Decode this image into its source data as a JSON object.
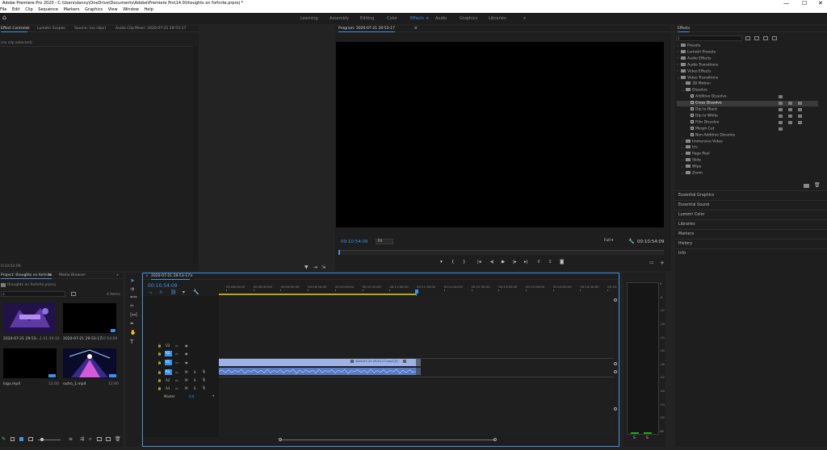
{
  "titlebar": {
    "title": "Adobe Premiere Pro 2020 - C:\\Users\\danny\\OneDrive\\Documents\\Adobe\\Premiere Pro\\14.0\\thoughts on fortnite.prproj *",
    "minimize": "—",
    "maximize": "☐"
  },
  "menu": [
    "File",
    "Edit",
    "Clip",
    "Sequence",
    "Markers",
    "Graphics",
    "View",
    "Window",
    "Help"
  ],
  "workspaces": {
    "items": [
      "Learning",
      "Assembly",
      "Editing",
      "Color",
      "Effects",
      "Audio",
      "Graphics",
      "Libraries"
    ],
    "active": "Effects",
    "more": "»",
    "menu_icon": "≡"
  },
  "source_panel": {
    "tabs": [
      "Effect Controls",
      "Lumetri Scopes",
      "Source: (no clips)",
      "Audio Clip Mixer: 2020-07-21 29-53-17"
    ],
    "tab_menu": "≡",
    "no_clip": "(no clip selected)",
    "timecode": "0:10:54:09"
  },
  "program": {
    "title": "Program: 2020-07-21 29-53-17",
    "timecode": "00:10:54:09",
    "fit": "Fit",
    "quality": "Full",
    "duration": "00:10:54:09"
  },
  "effects_panel": {
    "title": "Effects",
    "search_placeholder": "",
    "tree": [
      {
        "label": "Presets",
        "level": 0,
        "kind": "folder"
      },
      {
        "label": "Lumetri Presets",
        "level": 0,
        "kind": "folder"
      },
      {
        "label": "Audio Effects",
        "level": 0,
        "kind": "folder"
      },
      {
        "label": "Audio Transitions",
        "level": 0,
        "kind": "folder"
      },
      {
        "label": "Video Effects",
        "level": 0,
        "kind": "folder"
      },
      {
        "label": "Video Transitions",
        "level": 0,
        "kind": "folder",
        "open": true
      },
      {
        "label": "3D Motion",
        "level": 1,
        "kind": "folder"
      },
      {
        "label": "Dissolve",
        "level": 1,
        "kind": "folder",
        "open": true
      },
      {
        "label": "Additive Dissolve",
        "level": 2,
        "kind": "fx"
      },
      {
        "label": "Cross Dissolve",
        "level": 2,
        "kind": "fx",
        "selected": true
      },
      {
        "label": "Dip to Black",
        "level": 2,
        "kind": "fx"
      },
      {
        "label": "Dip to White",
        "level": 2,
        "kind": "fx"
      },
      {
        "label": "Film Dissolve",
        "level": 2,
        "kind": "fx"
      },
      {
        "label": "Morph Cut",
        "level": 2,
        "kind": "fx"
      },
      {
        "label": "Non-Additive Dissolve",
        "level": 2,
        "kind": "fx"
      },
      {
        "label": "Immersive Video",
        "level": 1,
        "kind": "folder"
      },
      {
        "label": "Iris",
        "level": 1,
        "kind": "folder"
      },
      {
        "label": "Page Peel",
        "level": 1,
        "kind": "folder"
      },
      {
        "label": "Slide",
        "level": 1,
        "kind": "folder"
      },
      {
        "label": "Wipe",
        "level": 1,
        "kind": "folder"
      },
      {
        "label": "Zoom",
        "level": 1,
        "kind": "folder"
      }
    ],
    "sections": [
      "Essential Graphics",
      "Essential Sound",
      "Lumetri Color",
      "Libraries",
      "Markers",
      "History",
      "Info"
    ]
  },
  "project_panel": {
    "tabs": [
      "Project: thoughts on fortnite",
      "Media Browser"
    ],
    "tab_menu": "≡",
    "more": "»",
    "project_file": "thoughts on fortnite.prproj",
    "item_count": "4 Items",
    "clips": [
      {
        "name": "2020-07-21 29-53-...",
        "duration": "1:41:39:16",
        "thumb": "purple"
      },
      {
        "name": "2020-07-21 29-53-17",
        "duration": "10:54:09",
        "thumb": "black"
      },
      {
        "name": "logo.mp4",
        "duration": "12:00",
        "thumb": "black"
      },
      {
        "name": "outro_1.mp4",
        "duration": "12:00",
        "thumb": "tunnel"
      }
    ]
  },
  "timeline": {
    "sequence_tab": "2020-07-21 29-53-17",
    "tab_menu": "≡",
    "timecode": "00:10:54:09",
    "ruler": [
      "00:08:00:00",
      "00:08:30:00",
      "00:09:00:00",
      "00:09:30:00",
      "00:10:00:00",
      "00:10:30:00",
      "00:11:00:00",
      "00:11:30:00",
      "00:12:00:00",
      "00:12:30:00",
      "00:13:00:00",
      "00:13:30:00",
      "00:14:00:00",
      "00:14:30:00",
      "00:15:"
    ],
    "video_tracks": [
      "V3",
      "V2",
      "V1"
    ],
    "audio_tracks": [
      "A1",
      "A2",
      "A3"
    ],
    "master": "Master",
    "master_value": "0.0",
    "video_clip_label": "2020-07-21 29-53-17.mp4 [V]",
    "fx_badge": "fx",
    "mute": "M",
    "solo": "S"
  },
  "meter": {
    "scale": [
      "0",
      "-6",
      "-12",
      "-18",
      "-24",
      "-30",
      "-36",
      "-42",
      "-48",
      "-54",
      "-60",
      "dB"
    ],
    "s1": "S",
    "s2": "S"
  }
}
